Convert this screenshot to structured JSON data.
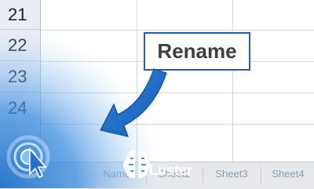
{
  "rows": [
    {
      "number": "21"
    },
    {
      "number": "22"
    },
    {
      "number": "23"
    },
    {
      "number": "24"
    }
  ],
  "callout": {
    "label": "Rename"
  },
  "sheet_tabs": [
    {
      "label": "Names"
    },
    {
      "label": "Sheet2"
    },
    {
      "label": "Sheet3"
    },
    {
      "label": "Sheet4"
    }
  ],
  "logo": {
    "line1": "Mind",
    "line2": "Luster"
  },
  "colors": {
    "accent_blue": "#1f6fc5",
    "callout_border": "#2b5aa8",
    "row_header_bg": "#e9edf4"
  },
  "icons": [
    "cursor-click-icon",
    "brain-icon",
    "arrow-icon"
  ]
}
